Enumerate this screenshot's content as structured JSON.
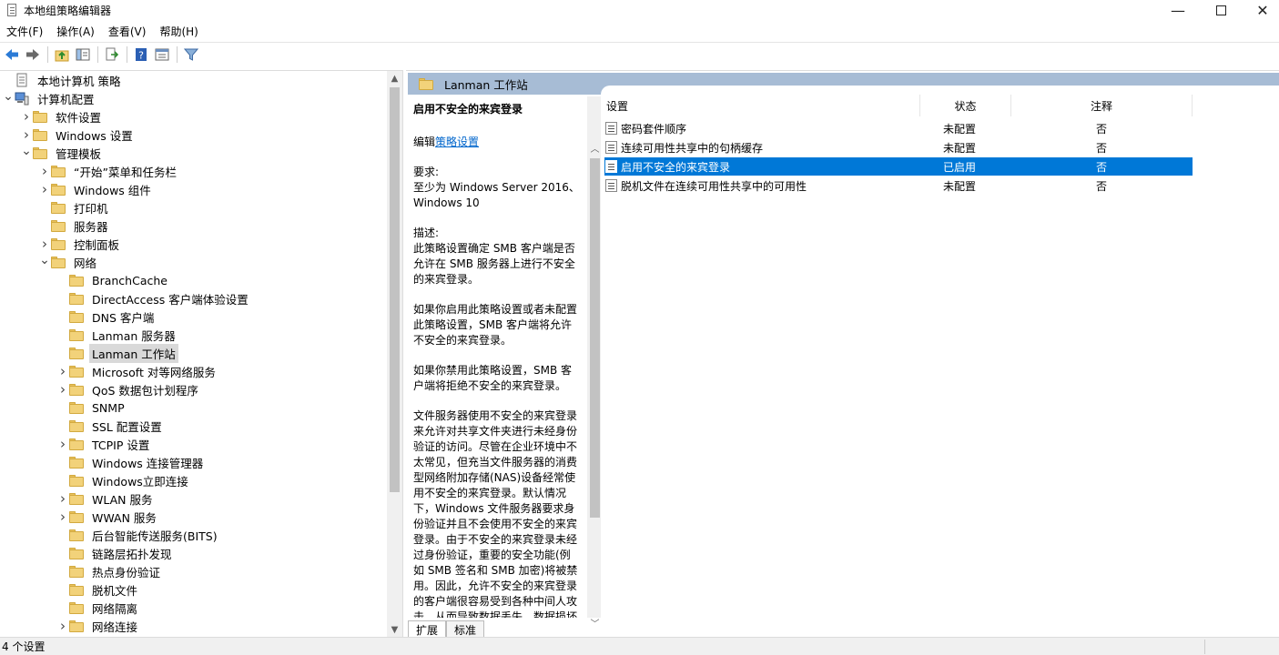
{
  "window": {
    "title": "本地组策略编辑器",
    "min_glyph": "—",
    "close_glyph": "✕"
  },
  "menu": [
    "文件(F)",
    "操作(A)",
    "查看(V)",
    "帮助(H)"
  ],
  "toolbar": [
    "back-icon",
    "forward-icon",
    "up-folder-icon",
    "show-hide-tree-icon",
    "export-list-icon",
    "help-icon",
    "properties-icon",
    "filter-icon"
  ],
  "tree": [
    {
      "label": "本地计算机 策略",
      "level": 0,
      "expander": "",
      "icon": "policy-doc-icon"
    },
    {
      "label": "计算机配置",
      "level": 0,
      "expander": "expanded",
      "icon": "computer-icon"
    },
    {
      "label": "软件设置",
      "level": 1,
      "expander": "collapsed",
      "icon": "folder-icon"
    },
    {
      "label": "Windows 设置",
      "level": 1,
      "expander": "collapsed",
      "icon": "folder-icon"
    },
    {
      "label": "管理模板",
      "level": 1,
      "expander": "expanded",
      "icon": "folder-icon"
    },
    {
      "label": "“开始”菜单和任务栏",
      "level": 2,
      "expander": "collapsed",
      "icon": "folder-icon"
    },
    {
      "label": "Windows 组件",
      "level": 2,
      "expander": "collapsed",
      "icon": "folder-icon"
    },
    {
      "label": "打印机",
      "level": 2,
      "expander": "",
      "icon": "folder-icon"
    },
    {
      "label": "服务器",
      "level": 2,
      "expander": "",
      "icon": "folder-icon"
    },
    {
      "label": "控制面板",
      "level": 2,
      "expander": "collapsed",
      "icon": "folder-icon"
    },
    {
      "label": "网络",
      "level": 2,
      "expander": "expanded",
      "icon": "folder-icon"
    },
    {
      "label": "BranchCache",
      "level": 3,
      "expander": "",
      "icon": "folder-icon"
    },
    {
      "label": "DirectAccess 客户端体验设置",
      "level": 3,
      "expander": "",
      "icon": "folder-icon"
    },
    {
      "label": "DNS 客户端",
      "level": 3,
      "expander": "",
      "icon": "folder-icon"
    },
    {
      "label": "Lanman 服务器",
      "level": 3,
      "expander": "",
      "icon": "folder-icon"
    },
    {
      "label": "Lanman 工作站",
      "level": 3,
      "expander": "",
      "icon": "folder-open-icon",
      "selected": true
    },
    {
      "label": "Microsoft 对等网络服务",
      "level": 3,
      "expander": "collapsed",
      "icon": "folder-icon"
    },
    {
      "label": "QoS 数据包计划程序",
      "level": 3,
      "expander": "collapsed",
      "icon": "folder-icon"
    },
    {
      "label": "SNMP",
      "level": 3,
      "expander": "",
      "icon": "folder-icon"
    },
    {
      "label": "SSL 配置设置",
      "level": 3,
      "expander": "",
      "icon": "folder-icon"
    },
    {
      "label": "TCPIP 设置",
      "level": 3,
      "expander": "collapsed",
      "icon": "folder-icon"
    },
    {
      "label": "Windows 连接管理器",
      "level": 3,
      "expander": "",
      "icon": "folder-icon"
    },
    {
      "label": "Windows立即连接",
      "level": 3,
      "expander": "",
      "icon": "folder-icon"
    },
    {
      "label": "WLAN 服务",
      "level": 3,
      "expander": "collapsed",
      "icon": "folder-icon"
    },
    {
      "label": "WWAN 服务",
      "level": 3,
      "expander": "collapsed",
      "icon": "folder-icon"
    },
    {
      "label": "后台智能传送服务(BITS)",
      "level": 3,
      "expander": "",
      "icon": "folder-icon"
    },
    {
      "label": "链路层拓扑发现",
      "level": 3,
      "expander": "",
      "icon": "folder-icon"
    },
    {
      "label": "热点身份验证",
      "level": 3,
      "expander": "",
      "icon": "folder-icon"
    },
    {
      "label": "脱机文件",
      "level": 3,
      "expander": "",
      "icon": "folder-icon"
    },
    {
      "label": "网络隔离",
      "level": 3,
      "expander": "",
      "icon": "folder-icon"
    },
    {
      "label": "网络连接",
      "level": 3,
      "expander": "collapsed",
      "icon": "folder-icon"
    }
  ],
  "right_header": {
    "title": "Lanman 工作站"
  },
  "description": {
    "heading": "启用不安全的来宾登录",
    "edit_prefix": "编辑",
    "edit_link": "策略设置",
    "requirements_label": "要求:",
    "requirements": "至少为 Windows Server 2016、Windows 10",
    "description_label": "描述:",
    "paragraphs": [
      "此策略设置确定 SMB 客户端是否允许在 SMB 服务器上进行不安全的来宾登录。",
      "如果你启用此策略设置或者未配置此策略设置，SMB 客户端将允许不安全的来宾登录。",
      "如果你禁用此策略设置，SMB 客户端将拒绝不安全的来宾登录。",
      "文件服务器使用不安全的来宾登录来允许对共享文件夹进行未经身份验证的访问。尽管在企业环境中不太常见，但充当文件服务器的消费型网络附加存储(NAS)设备经常使用不安全的来宾登录。默认情况下，Windows 文件服务器要求身份验证并且不会使用不安全的来宾登录。由于不安全的来宾登录未经过身份验证，重要的安全功能(例如 SMB 签名和 SMB 加密)将被禁用。因此，允许不安全的来宾登录的客户端很容易受到各种中间人攻击，从而导致数据丢失、数据损坏"
    ]
  },
  "list": {
    "columns": {
      "setting": "设置",
      "state": "状态",
      "note": "注释"
    },
    "rows": [
      {
        "name": "密码套件顺序",
        "state": "未配置",
        "note": "否",
        "selected": false
      },
      {
        "name": "连续可用性共享中的句柄缓存",
        "state": "未配置",
        "note": "否",
        "selected": false
      },
      {
        "name": "启用不安全的来宾登录",
        "state": "已启用",
        "note": "否",
        "selected": true
      },
      {
        "name": "脱机文件在连续可用性共享中的可用性",
        "state": "未配置",
        "note": "否",
        "selected": false
      }
    ]
  },
  "tabs": [
    "扩展",
    "标准"
  ],
  "status": {
    "text": "4 个设置"
  },
  "colors": {
    "selection": "#0078d7",
    "header_bar": "#a7bcd5",
    "folder": "#f2d27a",
    "link": "#0066cc"
  }
}
